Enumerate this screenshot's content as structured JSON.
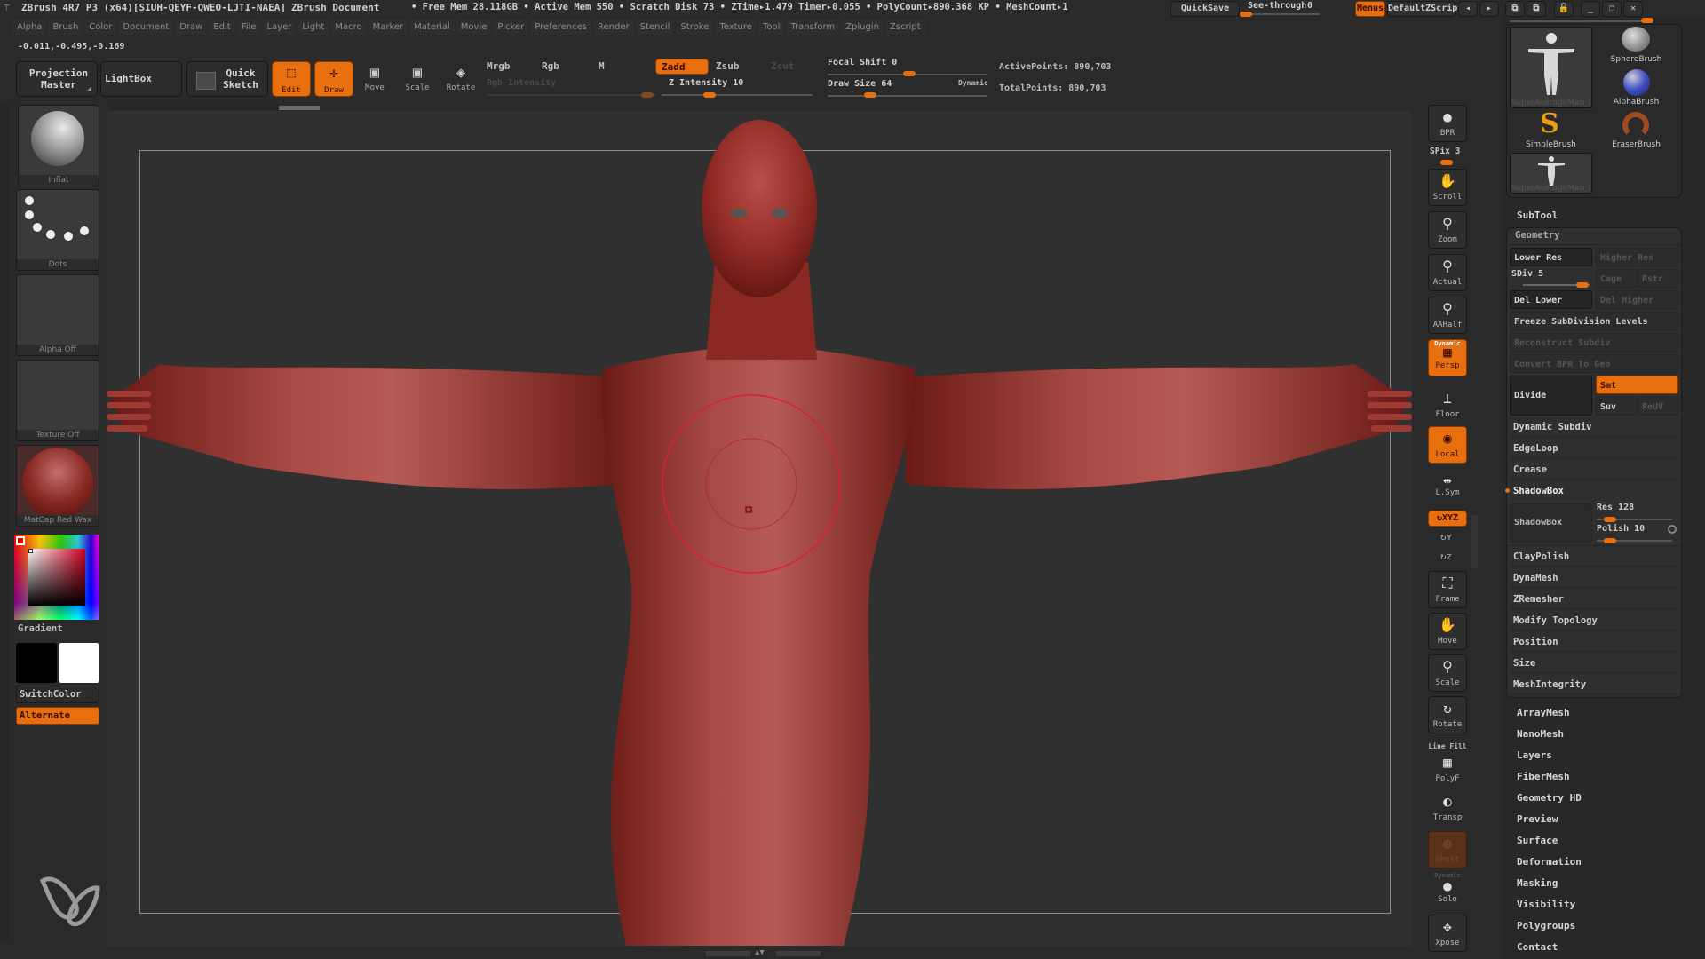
{
  "titlebar": {
    "app_title": "ZBrush 4R7 P3 (x64)[SIUH-QEYF-QWEO-LJTI-NAEA]",
    "document": "ZBrush Document",
    "stats": "• Free Mem 28.118GB • Active Mem 550 • Scratch Disk 73 •  ZTime▸1.479 Timer▸0.055 • PolyCount▸890.368 KP  • MeshCount▸1",
    "quicksave": "QuickSave",
    "see_through_label": "See-through",
    "see_through_value": "0",
    "menus": "Menus",
    "default_zscript": "DefaultZScript"
  },
  "menubar": [
    "Alpha",
    "Brush",
    "Color",
    "Document",
    "Draw",
    "Edit",
    "File",
    "Layer",
    "Light",
    "Macro",
    "Marker",
    "Material",
    "Movie",
    "Picker",
    "Preferences",
    "Render",
    "Stencil",
    "Stroke",
    "Texture",
    "Tool",
    "Transform",
    "Zplugin",
    "Zscript"
  ],
  "coords": "-0.011,-0.495,-0.169",
  "toolbar": {
    "projection_master": "Projection Master",
    "lightbox": "LightBox",
    "quick_sketch": "Quick Sketch",
    "edit": "Edit",
    "draw": "Draw",
    "move": "Move",
    "scale": "Scale",
    "rotate": "Rotate",
    "mrgb": "Mrgb",
    "rgb": "Rgb",
    "m": "M",
    "rgb_intensity": "Rgb Intensity",
    "zadd": "Zadd",
    "zsub": "Zsub",
    "zcut": "Zcut",
    "z_intensity_label": "Z Intensity",
    "z_intensity": "10",
    "focal_shift_label": "Focal Shift",
    "focal_shift": "0",
    "draw_size_label": "Draw Size",
    "draw_size": "64",
    "dynamic": "Dynamic",
    "active_points": "ActivePoints: 890,703",
    "total_points": "TotalPoints: 890,703"
  },
  "left_shelf": {
    "brush": "Inflat",
    "stroke": "Dots",
    "alpha": "Alpha Off",
    "texture": "Texture Off",
    "material": "MatCap Red Wax",
    "gradient": "Gradient",
    "switch_color": "SwitchColor",
    "alternate": "Alternate"
  },
  "right_shelf": [
    {
      "name": "bpr",
      "label": "BPR",
      "glyph": "●"
    },
    {
      "name": "scroll",
      "label": "Scroll",
      "glyph": "✋"
    },
    {
      "name": "zoom",
      "label": "Zoom",
      "glyph": "⚲"
    },
    {
      "name": "actual",
      "label": "Actual",
      "glyph": "⚲"
    },
    {
      "name": "aahalf",
      "label": "AAHalf",
      "glyph": "⚲"
    },
    {
      "name": "persp",
      "label": "Persp",
      "glyph": "▦"
    },
    {
      "name": "floor",
      "label": "Floor",
      "glyph": "⊥"
    },
    {
      "name": "local",
      "label": "Local",
      "glyph": "◉"
    },
    {
      "name": "lsym",
      "label": "L.Sym",
      "glyph": "⇹"
    },
    {
      "name": "frame",
      "label": "Frame",
      "glyph": "⛶"
    },
    {
      "name": "move",
      "label": "Move",
      "glyph": "✋"
    },
    {
      "name": "scale",
      "label": "Scale",
      "glyph": "⚲"
    },
    {
      "name": "rotate",
      "label": "Rotate",
      "glyph": "↻"
    },
    {
      "name": "polyf",
      "label": "PolyF",
      "glyph": "▦"
    },
    {
      "name": "transp",
      "label": "Transp",
      "glyph": "◐"
    },
    {
      "name": "ghost",
      "label": "Ghost",
      "glyph": "◍"
    },
    {
      "name": "solo",
      "label": "Solo",
      "glyph": "●"
    },
    {
      "name": "xpose",
      "label": "Xpose",
      "glyph": "✥"
    }
  ],
  "right_shelf_extra": {
    "spix": "SPix 3",
    "dynamic": "Dynamic",
    "xyz": "XYZ",
    "line_fill": "Line Fill"
  },
  "tool_palette": {
    "thumbs": [
      {
        "label": "SuperAverageMan_l"
      },
      {
        "label": "SphereBrush"
      },
      {
        "label": "AlphaBrush"
      },
      {
        "label": "SimpleBrush"
      },
      {
        "label": "EraserBrush"
      },
      {
        "label": "SuperAverageMan_l"
      }
    ],
    "subtool": "SubTool",
    "geometry": "Geometry",
    "lower_res": "Lower Res",
    "higher_res": "Higher Res",
    "sdiv": "SDiv 5",
    "cage": "Cage",
    "rstr": "Rstr",
    "del_lower": "Del Lower",
    "del_higher": "Del Higher",
    "freeze": "Freeze SubDivision Levels",
    "reconstruct": "Reconstruct Subdiv",
    "convert_bpr": "Convert BPR To Geo",
    "divide": "Divide",
    "smt": "Smt",
    "suv": "Suv",
    "reuv": "ReUV",
    "dynamic_subdiv": "Dynamic Subdiv",
    "edgeloop": "EdgeLoop",
    "crease": "Crease",
    "shadowbox_header": "ShadowBox",
    "shadowbox_btn": "ShadowBox",
    "res": "Res 128",
    "polish": "Polish 10",
    "geometry_items": [
      "ClayPolish",
      "DynaMesh",
      "ZRemesher",
      "Modify Topology",
      "Position",
      "Size",
      "MeshIntegrity"
    ],
    "subpalettes": [
      "ArrayMesh",
      "NanoMesh",
      "Layers",
      "FiberMesh",
      "Geometry HD",
      "Preview",
      "Surface",
      "Deformation",
      "Masking",
      "Visibility",
      "Polygroups",
      "Contact"
    ]
  },
  "colors": {
    "accent": "#e86f10",
    "background": "#2a2a2a",
    "canvas": "#303030",
    "model": "#9b2f2a"
  }
}
